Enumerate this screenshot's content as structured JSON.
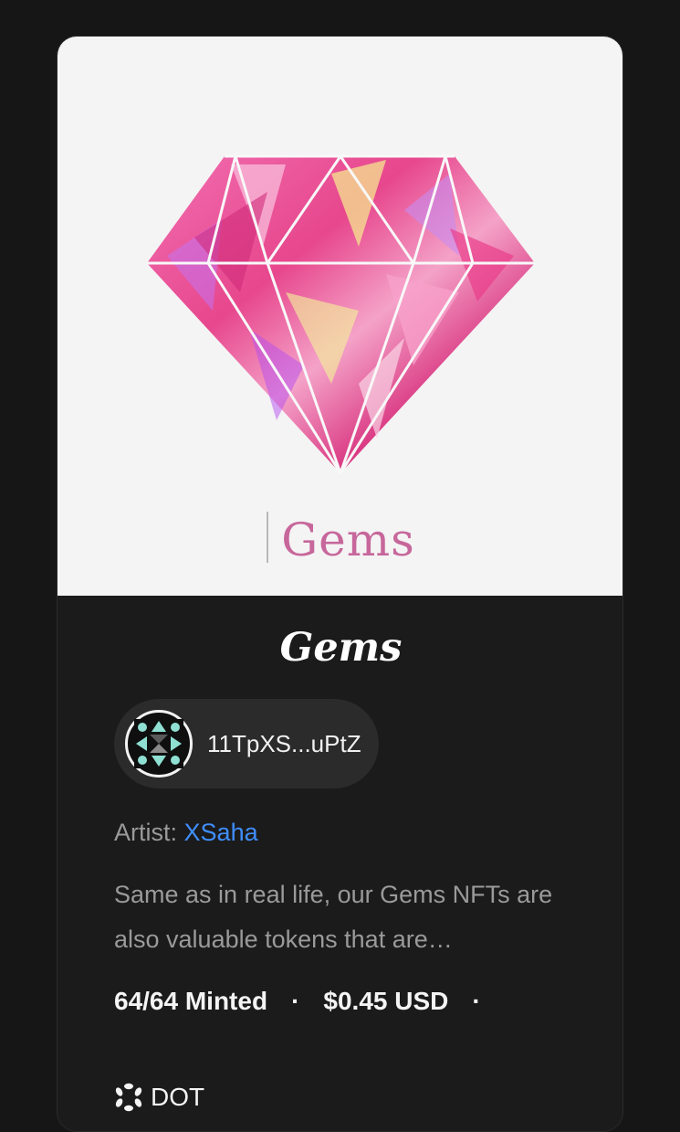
{
  "nft": {
    "image_wordmark": "Gems",
    "title": "Gems",
    "owner": "11TpXS...uPtZ",
    "artist_label": "Artist:",
    "artist_name": "XSaha",
    "description": "Same as in real life, our Gems NFTs are also valuable tokens that are…",
    "minted": "64/64 Minted",
    "separator": "·",
    "price": "$0.45 USD",
    "chain": "DOT"
  },
  "colors": {
    "background": "#161616",
    "card": "#1b1b1b",
    "chip": "#2b2b2b",
    "link": "#3f8efc",
    "gem_pink": "#e84a8f",
    "text_muted": "#9a9a9a"
  },
  "icons": {
    "avatar": "geometric-pattern-icon",
    "chain": "polkadot-icon"
  }
}
